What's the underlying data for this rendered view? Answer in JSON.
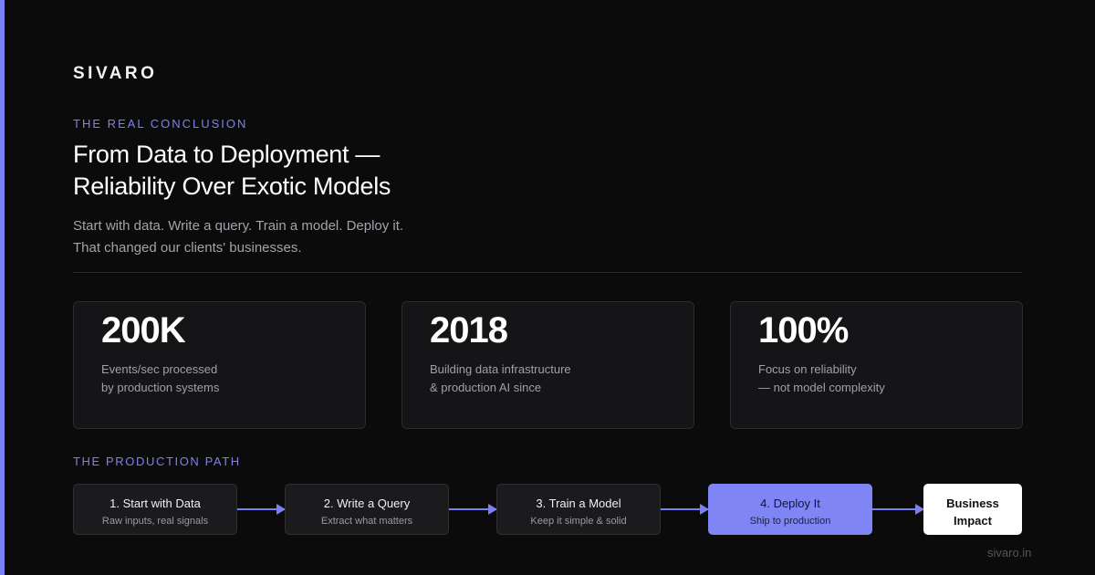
{
  "brand": "SIVARO",
  "eyebrow": "THE REAL CONCLUSION",
  "headline": [
    "From Data to Deployment —",
    "Reliability Over Exotic Models"
  ],
  "subtext": [
    "Start with data. Write a query. Train a model. Deploy it.",
    "That changed our clients' businesses."
  ],
  "stats": [
    {
      "value": "200K",
      "desc": [
        "Events/sec processed",
        "by production systems"
      ]
    },
    {
      "value": "2018",
      "desc": [
        "Building data infrastructure",
        "& production AI since"
      ]
    },
    {
      "value": "100%",
      "desc": [
        "Focus on reliability",
        "— not model complexity"
      ]
    }
  ],
  "path_title": "THE PRODUCTION PATH",
  "steps": [
    {
      "title": "1. Start with Data",
      "sub": "Raw inputs, real signals"
    },
    {
      "title": "2. Write a Query",
      "sub": "Extract what matters"
    },
    {
      "title": "3. Train a Model",
      "sub": "Keep it simple & solid"
    },
    {
      "title": "4. Deploy It",
      "sub": "Ship to production"
    }
  ],
  "final": [
    "Business",
    "Impact"
  ],
  "footer_url": "sivaro.in",
  "colors": {
    "accent": "#7b80f4",
    "background": "#0b0b0c",
    "card": "#151517"
  }
}
